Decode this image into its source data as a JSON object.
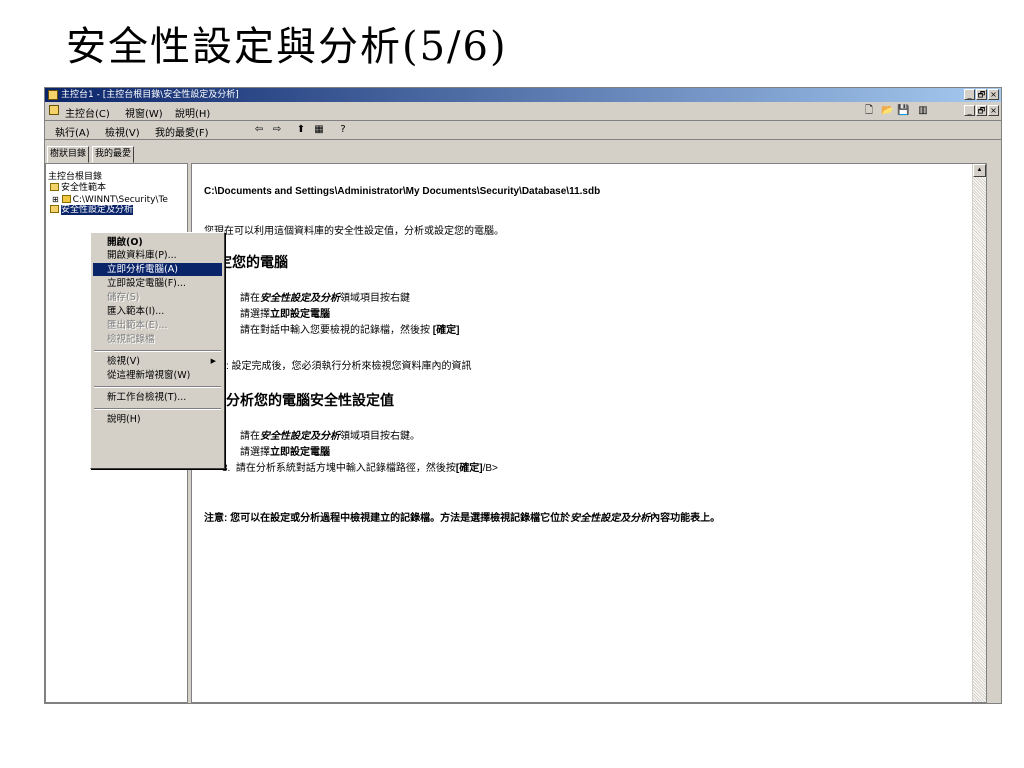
{
  "slide_title": "安全性設定與分析(5/6)",
  "window": {
    "title": "主控台1 - [主控台根目錄\\安全性設定及分析]",
    "controls": {
      "minimize": "_",
      "maximize": "🗗",
      "close": "×"
    }
  },
  "menubar": {
    "console": "主控台(C)",
    "window": "視窗(W)",
    "help": "說明(H)"
  },
  "actionbar": {
    "action": "執行(A)",
    "view": "檢視(V)",
    "favorites": "我的最愛(F)"
  },
  "panel_tabs": {
    "tree": "樹狀目錄",
    "favorites": "我的最愛"
  },
  "tree": {
    "root": "主控台根目錄",
    "item1": "安全性範本",
    "item2": "C:\\WINNT\\Security\\Te",
    "item3": "安全性設定及分析"
  },
  "context_menu": {
    "open": "開啟(O)",
    "open_db": "開啟資料庫(P)...",
    "analyze": "立即分析電腦(A)",
    "configure": "立即設定電腦(F)...",
    "save": "儲存(S)",
    "import": "匯入範本(I)...",
    "export": "匯出範本(E)...",
    "view_log": "檢視記錄檔",
    "view": "檢視(V)",
    "new_window": "從這裡新增視窗(W)",
    "new_taskpad": "新工作台檢視(T)...",
    "help": "說明(H)"
  },
  "content": {
    "path": "C:\\Documents and Settings\\Administrator\\My Documents\\Security\\Database\\11.sdb",
    "intro": "您現在可以利用這個資料庫的安全性設定值，分析或設定您的電腦。",
    "h_configure": "設定您的電腦",
    "c1_pre": "請在",
    "c1_em": "安全性設定及分析",
    "c1_post": "領域項目按右鍵",
    "c2_pre": "請選擇",
    "c2_bold": "立即設定電腦",
    "c3_pre": "請在對話中輸入您要檢視的記錄檔，然後按 ",
    "c3_bold": "[確定]",
    "note1": ": 設定完成後，您必須執行分析來檢視您資料庫內的資訊",
    "h_analyze": "分析您的電腦安全性設定值",
    "a1_pre": "請在",
    "a1_em": "安全性設定及分析",
    "a1_post": "領域項目按右鍵。",
    "a2_pre": "請選擇",
    "a2_bold": "立即設定電腦",
    "a3_num": "3.",
    "a3_pre": "請在分析系統對話方塊中輸入記錄檔路徑，然後按",
    "a3_bold": "[確定]",
    "a3_post": "/B>",
    "note2_pre": "注意: 您可以在設定或分析過程中檢視建立的記錄檔。方法是選擇檢視記錄檔它位於",
    "note2_em": "安全性設定及分析",
    "note2_post": "內容功能表上。"
  }
}
